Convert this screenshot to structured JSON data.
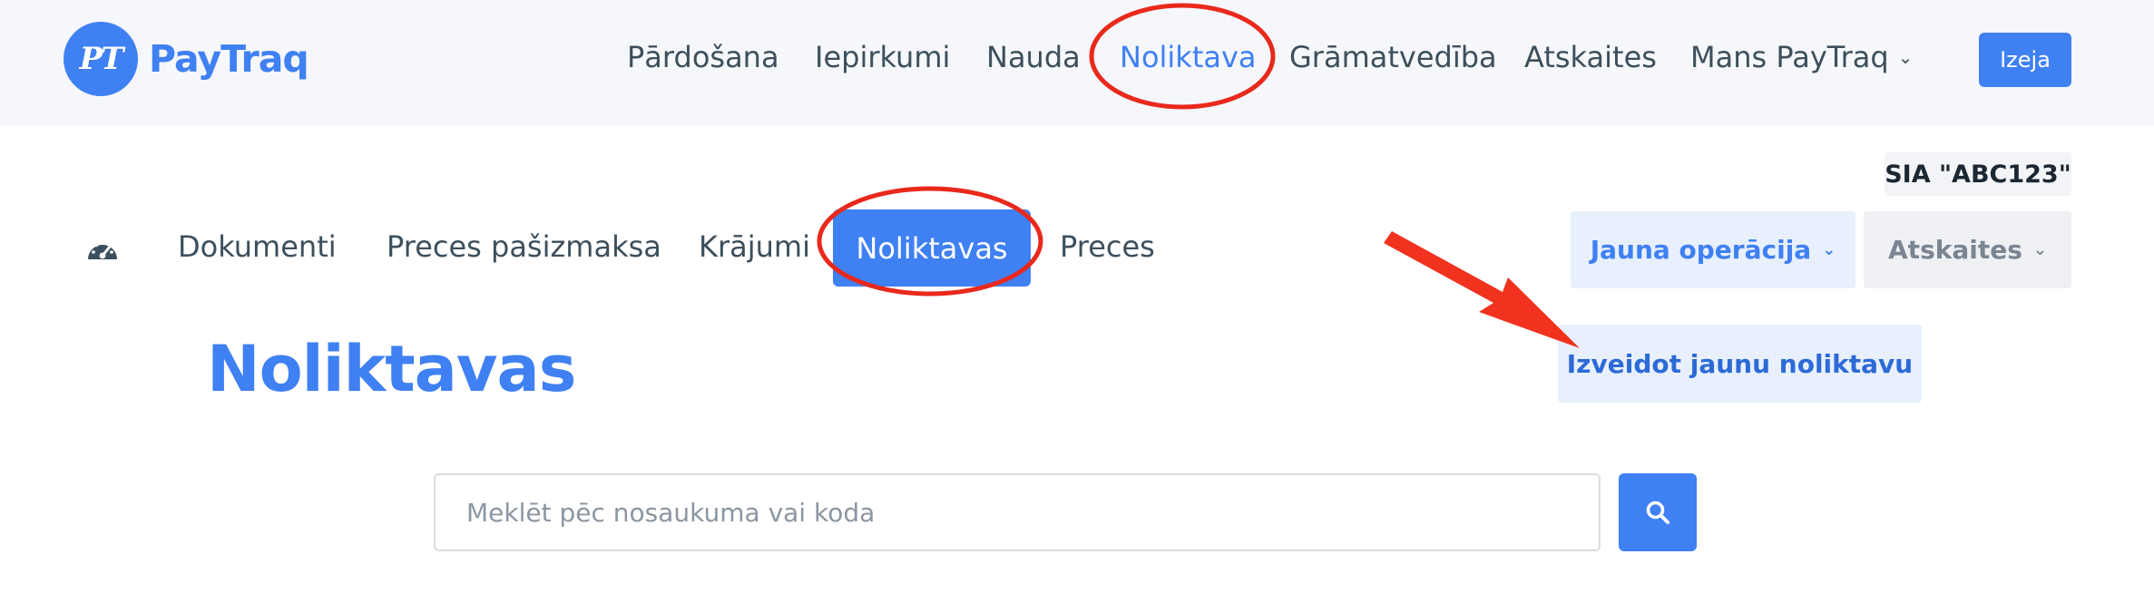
{
  "brand": {
    "logo_mark": "PT",
    "name": "PayTraq"
  },
  "top_nav": {
    "items": [
      {
        "label": "Pārdošana"
      },
      {
        "label": "Iepirkumi"
      },
      {
        "label": "Nauda"
      },
      {
        "label": "Noliktava",
        "active": true
      },
      {
        "label": "Grāmatvedība"
      },
      {
        "label": "Atskaites"
      },
      {
        "label": "Mans PayTraq",
        "icon": "chevron-down-icon"
      }
    ],
    "exit_label": "Izeja"
  },
  "company": "SIA \"ABC123\"",
  "sub_nav": {
    "dashboard_icon": "speedometer-icon",
    "items": [
      {
        "label": "Dokumenti"
      },
      {
        "label": "Preces pašizmaksa"
      },
      {
        "label": "Krājumi"
      },
      {
        "label": "Noliktavas",
        "active": true
      },
      {
        "label": "Preces"
      }
    ],
    "new_operation_label": "Jauna operācija",
    "reports_label": "Atskaites"
  },
  "page": {
    "title": "Noliktavas",
    "create_label": "Izveidot jaunu noliktavu"
  },
  "search": {
    "placeholder": "Meklēt pēc nosaukuma vai koda",
    "value": "",
    "icon": "search-icon"
  },
  "annotations": {
    "highlight_color": "#e8291c",
    "accent": "#3f80f3"
  }
}
